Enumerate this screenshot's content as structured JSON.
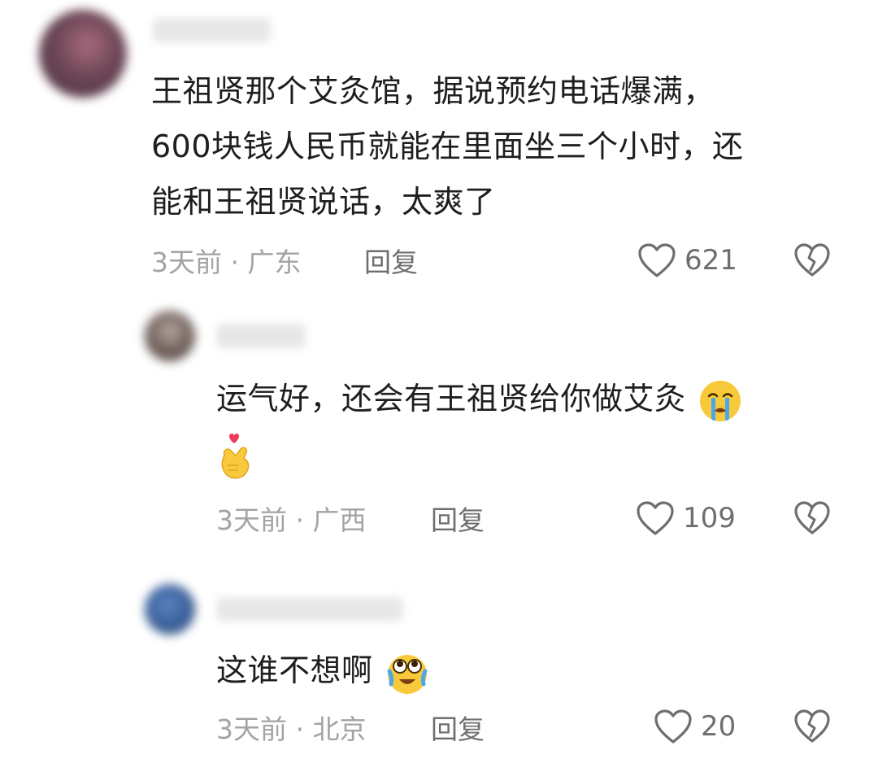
{
  "comments": [
    {
      "text_lines": [
        "王祖贤那个艾灸馆，据说预约电话爆满，",
        "600块钱人民币就能在里面坐三个小时，还",
        "能和王祖贤说话，太爽了"
      ],
      "meta": "3天前 · 广东",
      "reply_label": "回复",
      "likes": "621"
    },
    {
      "text": "运气好，还会有王祖贤给你做艾灸",
      "meta": "3天前 · 广西",
      "reply_label": "回复",
      "likes": "109",
      "emojis": [
        "crying-face-emoji",
        "finger-heart-emoji"
      ]
    },
    {
      "text": "这谁不想啊",
      "meta": "3天前 · 北京",
      "reply_label": "回复",
      "likes": "20",
      "emojis": [
        "crying-laugh-emoji"
      ]
    }
  ],
  "colors": {
    "text": "#1e1e1e",
    "meta": "#a3a3a3",
    "action": "#6e6e6e",
    "background": "#ffffff"
  },
  "icons": [
    "heart-outline-icon",
    "broken-heart-icon"
  ]
}
